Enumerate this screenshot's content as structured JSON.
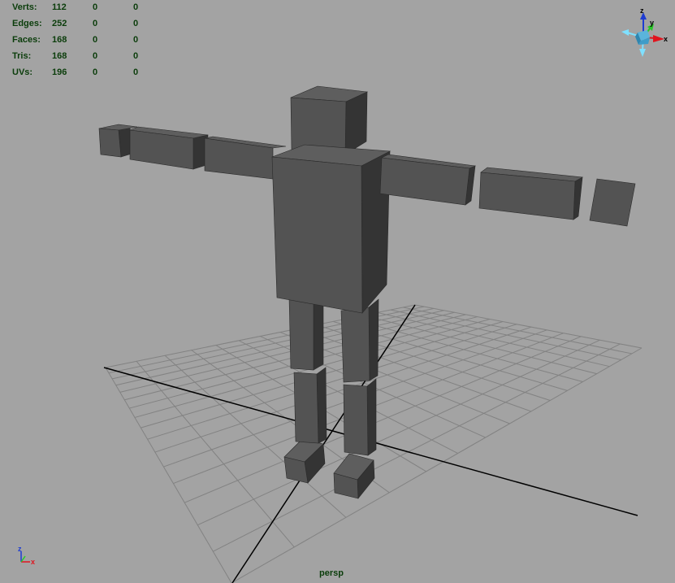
{
  "stats": [
    {
      "label": "Verts:",
      "value": "112",
      "selected": "0",
      "component": "0"
    },
    {
      "label": "Edges:",
      "value": "252",
      "selected": "0",
      "component": "0"
    },
    {
      "label": "Faces:",
      "value": "168",
      "selected": "0",
      "component": "0"
    },
    {
      "label": "Tris:",
      "value": "168",
      "selected": "0",
      "component": "0"
    },
    {
      "label": "UVs:",
      "value": "196",
      "selected": "0",
      "component": "0"
    }
  ],
  "camera": "persp",
  "view_cube": {
    "z": "z",
    "y": "y",
    "x": "x"
  },
  "origin_axis": {
    "z": "z",
    "x": "x"
  },
  "colors": {
    "background": "#a3a3a3",
    "grid": "#7f7f7f",
    "axis_lines": "#000000",
    "mesh_front": "#535353",
    "mesh_top": "#5e5e5e",
    "mesh_side": "#343434",
    "hud_text": "#0b3d0b",
    "x_axis": "#e0141e",
    "y_axis": "#28c828",
    "z_axis": "#1e3cd2"
  }
}
